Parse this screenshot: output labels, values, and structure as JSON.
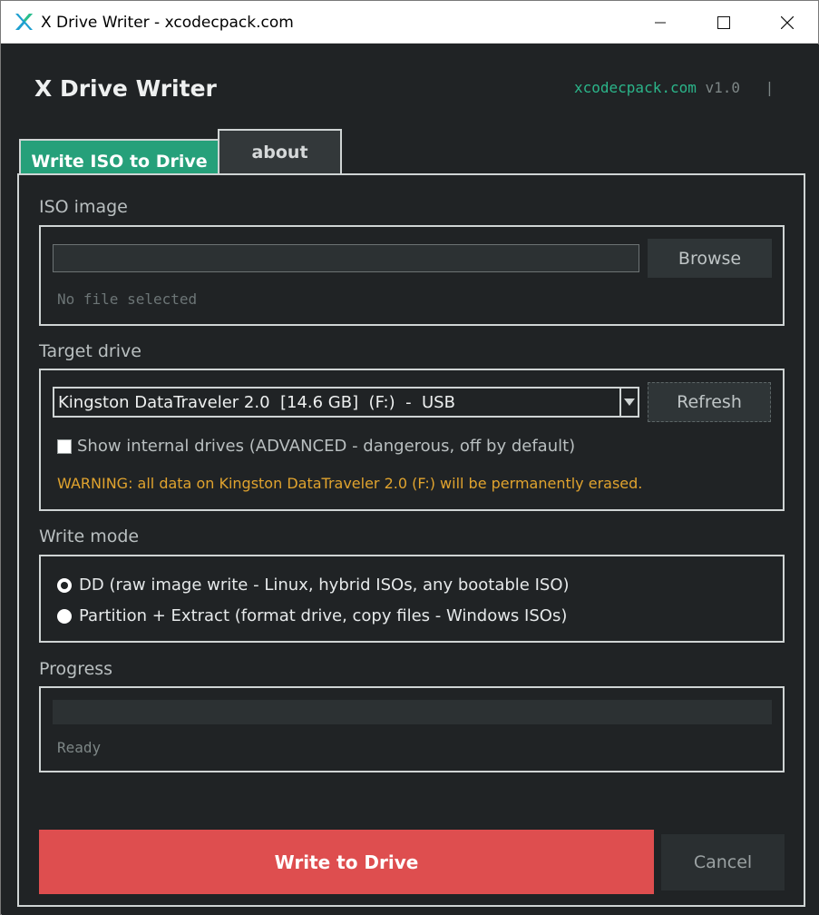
{
  "window": {
    "title": "X Drive Writer - xcodecpack.com",
    "controls": {
      "minimize": "—",
      "maximize": "☐",
      "close": "✕"
    }
  },
  "header": {
    "app_name": "X Drive Writer",
    "site": "xcodecpack.com",
    "version": "v1.0",
    "separator": "|"
  },
  "tabs": [
    {
      "label": "Write ISO to Drive",
      "active": true
    },
    {
      "label": "about",
      "active": false
    }
  ],
  "iso_image": {
    "label": "ISO image",
    "path_value": "",
    "browse_label": "Browse",
    "status": "No file selected"
  },
  "target_drive": {
    "label": "Target drive",
    "selected": "Kingston DataTraveler 2.0  [14.6 GB]  (F:)  -  USB",
    "refresh_label": "Refresh",
    "show_internal_label": "Show internal drives (ADVANCED - dangerous, off by default)",
    "show_internal_checked": false,
    "warning": "WARNING: all data on Kingston DataTraveler 2.0 (F:) will be permanently erased."
  },
  "write_mode": {
    "label": "Write mode",
    "options": [
      {
        "label": "DD (raw image write - Linux, hybrid ISOs, any bootable ISO)",
        "selected": true
      },
      {
        "label": "Partition + Extract (format drive, copy files - Windows ISOs)",
        "selected": false
      }
    ]
  },
  "progress": {
    "label": "Progress",
    "value": 0,
    "status": "Ready"
  },
  "actions": {
    "write_label": "Write to Drive",
    "cancel_label": "Cancel"
  },
  "colors": {
    "accent": "#26a07a",
    "danger": "#de4e4f",
    "warning": "#e0a32e",
    "background": "#202325"
  }
}
